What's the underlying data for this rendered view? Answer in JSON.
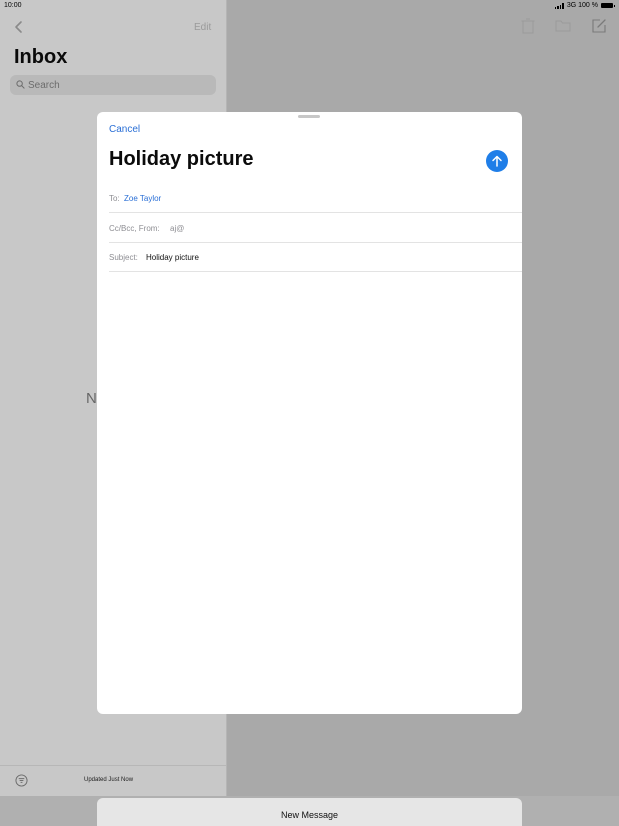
{
  "status_bar": {
    "time": "10:00",
    "network": "3G 100 %"
  },
  "inbox": {
    "edit_label": "Edit",
    "title": "Inbox",
    "search_placeholder": "Search",
    "partial_text": "N",
    "updated": "Updated Just Now",
    "icons": [
      "back-chevron-icon",
      "search-icon",
      "filter-icon"
    ]
  },
  "toolbar": {
    "icons": [
      "trash-icon",
      "folder-icon",
      "compose-icon"
    ]
  },
  "compose": {
    "cancel_label": "Cancel",
    "title": "Holiday picture",
    "to_label": "To:",
    "to_value": "Zoe Taylor",
    "ccbcc_label": "Cc/Bcc, From:",
    "ccbcc_value": "aj@",
    "subject_label": "Subject:",
    "subject_value": "Holiday picture",
    "send_icon": "arrow-up-icon"
  },
  "bottom_tab": {
    "label": "New Message"
  },
  "colors": {
    "accent": "#1f7ee8",
    "link": "#2a6fd6"
  }
}
